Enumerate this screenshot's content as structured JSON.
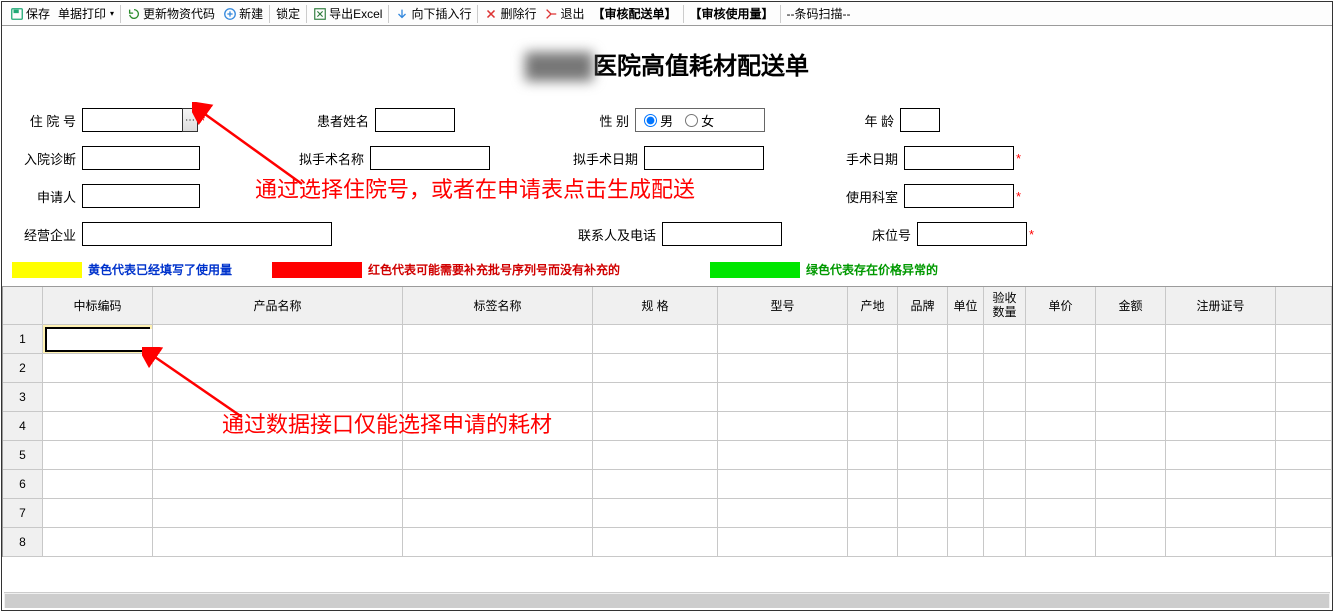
{
  "toolbar": {
    "save": "保存",
    "print": "单据打印",
    "refresh_code": "更新物资代码",
    "new": "新建",
    "lock": "锁定",
    "export_excel": "导出Excel",
    "insert_row": "向下插入行",
    "delete_row": "删除行",
    "exit": "退出",
    "audit_delivery": "【审核配送单】",
    "audit_usage": "【审核使用量】",
    "barcode": "--条码扫描--"
  },
  "title": {
    "prefix_obscured": "████",
    "suffix": "医院高值耗材配送单"
  },
  "form": {
    "hosp_no_label": "住 院  号",
    "patient_name_label": "患者姓名",
    "sex_label": "性  别",
    "sex_male": "男",
    "sex_female": "女",
    "age_label": "年  龄",
    "diagnosis_label": "入院诊断",
    "surgery_name_label": "拟手术名称",
    "surgery_date_label": "拟手术日期",
    "op_date_label": "手术日期",
    "applicant_label": "申请人",
    "applicant_value": "",
    "use_dept_label": "使用科室",
    "company_label": "经营企业",
    "contact_label": "联系人及电话",
    "bed_label": "床位号"
  },
  "legend": {
    "yellow": "黄色代表已经填写了使用量",
    "red": "红色代表可能需要补充批号序列号而没有补充的",
    "green": "绿色代表存在价格异常的"
  },
  "columns": {
    "tender": "中标编码",
    "product": "产品名称",
    "label": "标签名称",
    "spec": "规  格",
    "model": "型号",
    "origin": "产地",
    "brand": "品牌",
    "unit": "单位",
    "qty": "验收\n数量",
    "price": "单价",
    "amount": "金额",
    "reg_no": "注册证号"
  },
  "row_numbers": [
    "1",
    "2",
    "3",
    "4",
    "5",
    "6",
    "7",
    "8"
  ],
  "annotations": {
    "line1": "通过选择住院号，或者在申请表点击生成配送",
    "line2": "通过数据接口仅能选择申请的耗材"
  }
}
